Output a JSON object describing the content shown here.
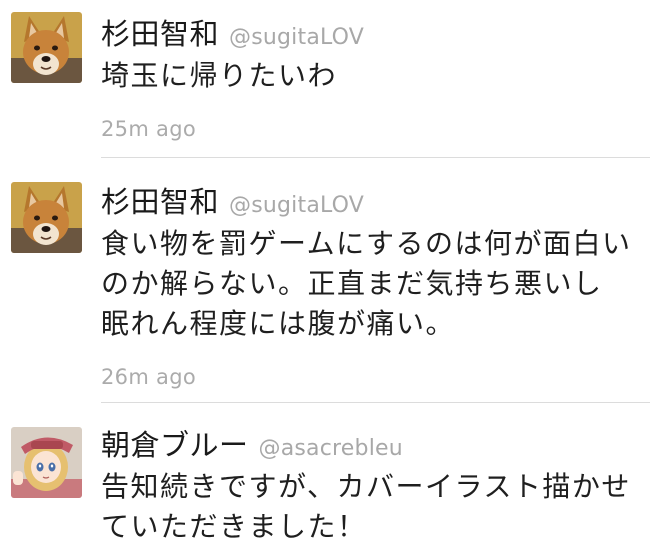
{
  "tweets": [
    {
      "display_name": "杉田智和",
      "handle": "@sugitaLOV",
      "avatar_icon": "shiba-dog-avatar-icon",
      "text_lines": [
        "埼玉に帰りたいわ"
      ],
      "timestamp": "25m ago"
    },
    {
      "display_name": "杉田智和",
      "handle": "@sugitaLOV",
      "avatar_icon": "shiba-dog-avatar-icon",
      "text_lines": [
        "食い物を罰ゲームにするのは何が面白い",
        "のか解らない。正直まだ気持ち悪いし",
        "眠れん程度には腹が痛い。"
      ],
      "timestamp": "26m ago"
    },
    {
      "display_name": "朝倉ブルー",
      "handle": "@asacrebleu",
      "avatar_icon": "anime-girl-avatar-icon",
      "text_lines": [
        "告知続きですが、カバーイラスト描かせ",
        "ていただきました！"
      ],
      "timestamp": ""
    }
  ],
  "colors": {
    "text": "#1f1f1f",
    "secondary": "#a8a8a8",
    "divider": "#dcdcdc"
  }
}
